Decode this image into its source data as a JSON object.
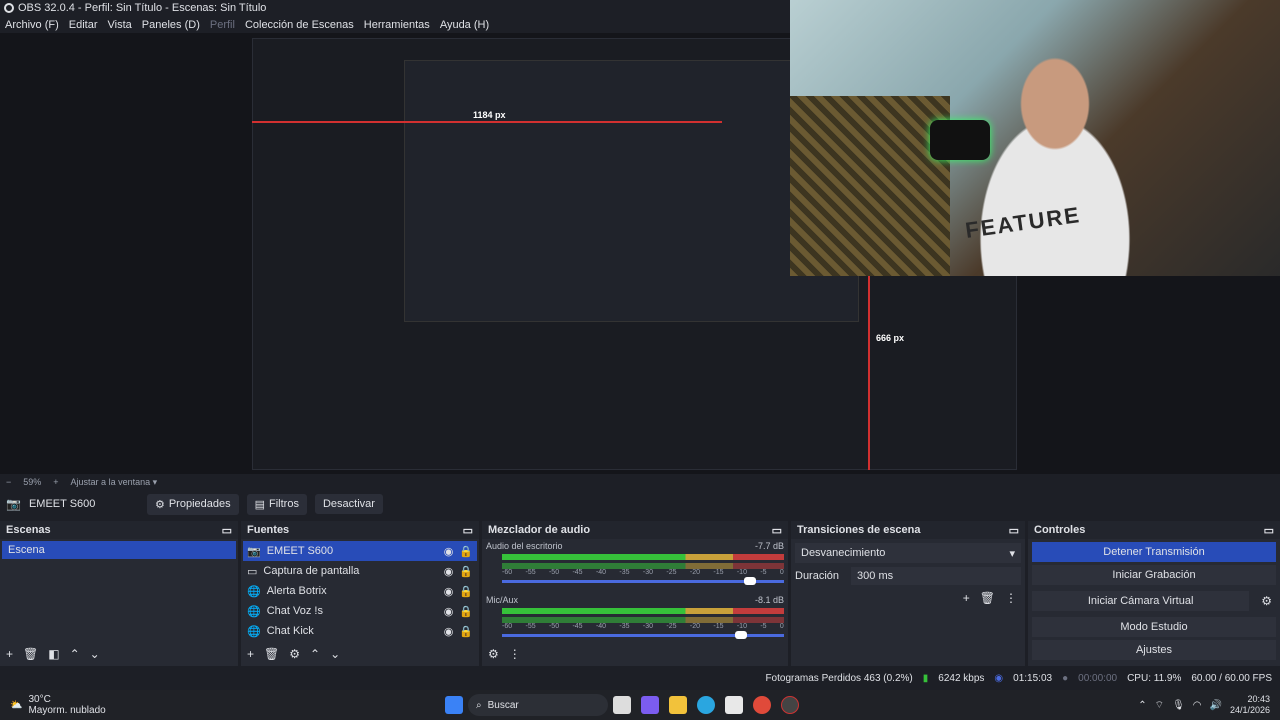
{
  "window": {
    "title": "OBS 32.0.4 - Perfil: Sin Título - Escenas: Sin Título"
  },
  "menu": [
    {
      "label": "Archivo (F)",
      "disabled": false
    },
    {
      "label": "Editar",
      "disabled": false
    },
    {
      "label": "Vista",
      "disabled": false
    },
    {
      "label": "Paneles (D)",
      "disabled": false
    },
    {
      "label": "Perfil",
      "disabled": true
    },
    {
      "label": "Colección de Escenas",
      "disabled": false
    },
    {
      "label": "Herramientas",
      "disabled": false
    },
    {
      "label": "Ayuda (H)",
      "disabled": false
    }
  ],
  "preview": {
    "measure_h": "1184 px",
    "measure_v": "666 px",
    "shirt_text": "FEATURE"
  },
  "zoom": {
    "minus": "−",
    "value": "59%",
    "plus": "+",
    "fit_label": "Ajustar a la ventana"
  },
  "sourcebar": {
    "source_name": "EMEET S600",
    "properties": "Propiedades",
    "filters": "Filtros",
    "deactivate": "Desactivar"
  },
  "scenes": {
    "title": "Escenas",
    "items": [
      "Escena"
    ]
  },
  "sources": {
    "title": "Fuentes",
    "items": [
      {
        "name": "EMEET S600",
        "icon": "camera-icon",
        "selected": true
      },
      {
        "name": "Captura de pantalla",
        "icon": "monitor-icon",
        "selected": false
      },
      {
        "name": "Alerta Botrix",
        "icon": "globe-icon",
        "selected": false
      },
      {
        "name": "Chat Voz !s",
        "icon": "globe-icon",
        "selected": false
      },
      {
        "name": "Chat Kick",
        "icon": "globe-icon",
        "selected": false
      }
    ]
  },
  "mixer": {
    "title": "Mezclador de audio",
    "channels": [
      {
        "name": "Audio del escritorio",
        "db": "-7.7 dB",
        "volume": 0.9
      },
      {
        "name": "Mic/Aux",
        "db": "-8.1 dB",
        "volume": 0.87
      }
    ],
    "scale": [
      "-60",
      "-55",
      "-50",
      "-45",
      "-40",
      "-35",
      "-30",
      "-25",
      "-20",
      "-15",
      "-10",
      "-5",
      "0"
    ]
  },
  "transitions": {
    "title": "Transiciones de escena",
    "selected": "Desvanecimiento",
    "duration_label": "Duración",
    "duration_value": "300 ms"
  },
  "controls": {
    "title": "Controles",
    "buttons": [
      "Detener Transmisión",
      "Iniciar Grabación",
      "Iniciar Cámara Virtual",
      "Modo Estudio",
      "Ajustes"
    ]
  },
  "status": {
    "dropped": "Fotogramas Perdidos 463 (0.2%)",
    "bitrate": "6242 kbps",
    "stream_time": "01:15:03",
    "rec_time": "00:00:00",
    "cpu": "CPU: 11.9%",
    "fps": "60.00 / 60.00 FPS"
  },
  "taskbar": {
    "temp": "30°C",
    "weather": "Mayorm. nublado",
    "search": "Buscar",
    "time": "20:43",
    "date": "24/1/2026"
  },
  "colors": {
    "accent": "#284cb8",
    "dock_bg": "#272a33",
    "app_bg": "#1d1f26",
    "meter_green": "#36c13a",
    "meter_yellow": "#c9a13a",
    "meter_red": "#c33c3c"
  }
}
